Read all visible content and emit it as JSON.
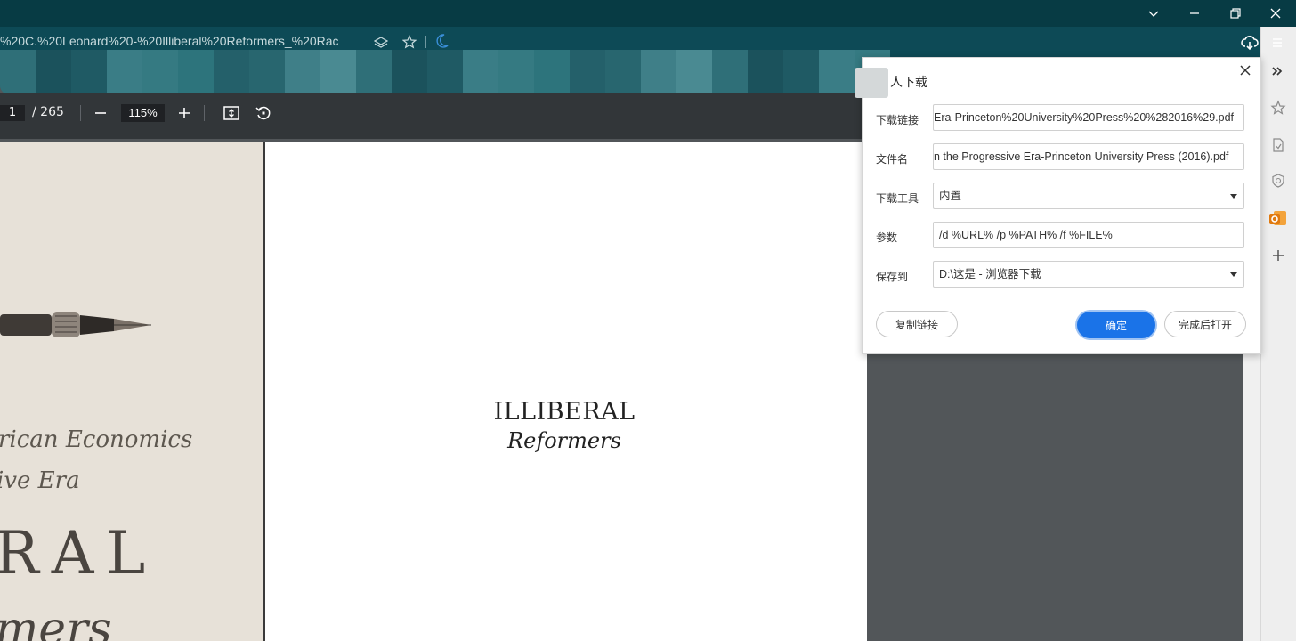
{
  "window": {
    "controls": [
      "chevron-down-icon",
      "minimize-icon",
      "restore-icon",
      "close-icon"
    ]
  },
  "address_bar": {
    "url_fragment": "%20C.%20Leonard%20-%20Illiberal%20Reformers_%20Rac"
  },
  "pdf_toolbar": {
    "current_page": "1",
    "page_total": "/ 265",
    "zoom": "115%"
  },
  "cover": {
    "line1": "rican Economics",
    "line2": "ive Era",
    "line3": "RAL",
    "line4": "mers"
  },
  "title_page": {
    "title": "ILLIBERAL",
    "subtitle": "Reformers"
  },
  "dialog": {
    "title": "人下载",
    "fields": {
      "link_label": "下载链接",
      "link_value": "Era-Princeton%20University%20Press%20%282016%29.pdf",
      "filename_label": "文件名",
      "filename_value": "n the Progressive Era-Princeton University Press (2016).pdf",
      "tool_label": "下载工具",
      "tool_value": "内置",
      "params_label": "参数",
      "params_value": "/d %URL% /p %PATH% /f %FILE%",
      "save_label": "保存到",
      "save_value": "D:\\这是 - 浏览器下载"
    },
    "buttons": {
      "copy_link": "复制链接",
      "confirm": "确定",
      "open_after": "完成后打开"
    }
  },
  "colors": {
    "titlebar": "#073b44",
    "pdf_toolbar": "#323639",
    "primary_button": "#1a73e8",
    "outlook_icon": "#e07a10"
  }
}
